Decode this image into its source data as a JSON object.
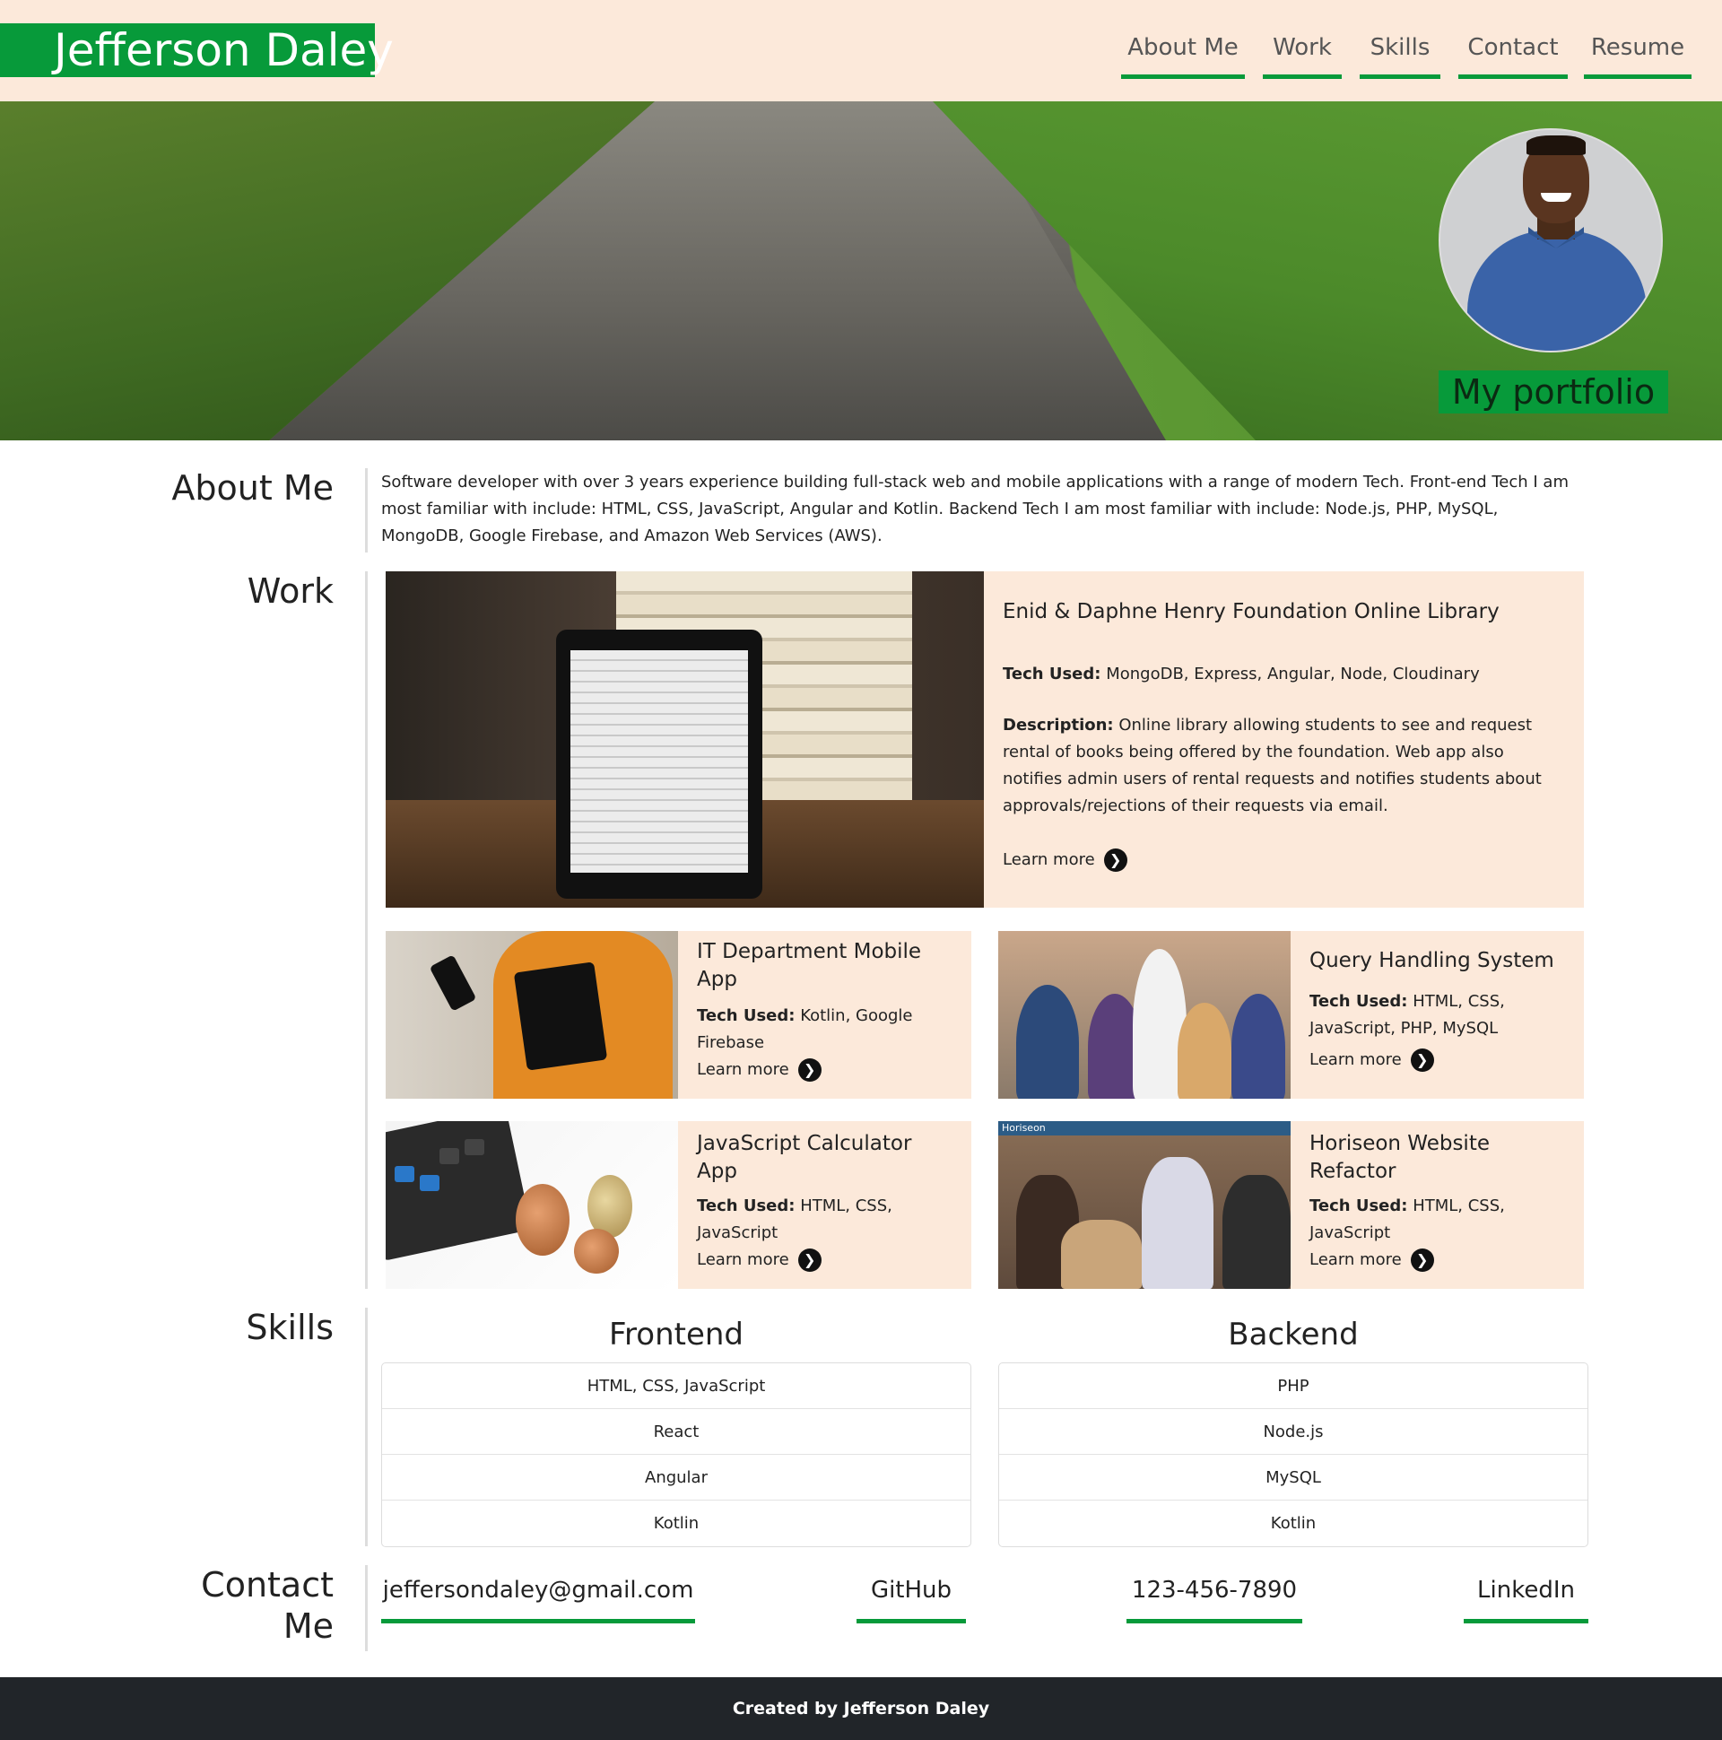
{
  "header": {
    "brand": "Jefferson Daley",
    "nav": [
      "About Me",
      "Work",
      "Skills",
      "Contact",
      "Resume"
    ]
  },
  "hero": {
    "tagline": "My portfolio"
  },
  "sections": {
    "about_title": "About Me",
    "work_title": "Work",
    "skills_title": "Skills",
    "contact_title": "Contact Me"
  },
  "about": {
    "text": "Software developer with over 3 years experience building full-stack web and mobile applications with a range of modern Tech. Front-end Tech I am most familiar with include: HTML, CSS, JavaScript, Angular and Kotlin. Backend Tech I am most familiar with include: Node.js, PHP, MySQL, MongoDB, Google Firebase, and Amazon Web Services (AWS)."
  },
  "work": {
    "tech_label": "Tech Used:",
    "desc_label": "Description:",
    "learn_more": "Learn more",
    "featured": {
      "title": "Enid & Daphne Henry Foundation Online Library",
      "tech": "MongoDB, Express, Angular, Node, Cloudinary",
      "description": "Online library allowing students to see and request rental of books being offered by the foundation. Web app also notifies admin users of rental requests and notifies students about approvals/rejections of their requests via email."
    },
    "projects": [
      {
        "title": "IT Department Mobile App",
        "tech": "Kotlin, Google Firebase"
      },
      {
        "title": "Query Handling System",
        "tech": "HTML, CSS, JavaScript, PHP, MySQL"
      },
      {
        "title": "JavaScript Calculator App",
        "tech": "HTML, CSS, JavaScript"
      },
      {
        "title": "Horiseon Website Refactor",
        "tech": "HTML, CSS, JavaScript"
      }
    ],
    "horiseon_banner": "Horiseon"
  },
  "skills": {
    "frontend_title": "Frontend",
    "backend_title": "Backend",
    "frontend": [
      "HTML, CSS, JavaScript",
      "React",
      "Angular",
      "Kotlin"
    ],
    "backend": [
      "PHP",
      "Node.js",
      "MySQL",
      "Kotlin"
    ]
  },
  "contact": {
    "email": "jeffersondaley@gmail.com",
    "github": "GitHub",
    "phone": "123-456-7890",
    "linkedin": "LinkedIn"
  },
  "footer": {
    "text": "Created by Jefferson Daley"
  },
  "colors": {
    "accent": "#079a3a",
    "header_bg": "#fce9da",
    "card_bg": "#fce9da",
    "footer_bg": "#212529"
  }
}
